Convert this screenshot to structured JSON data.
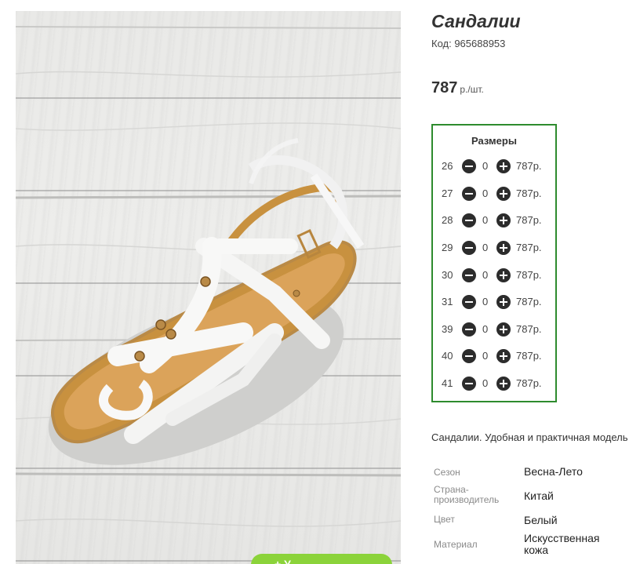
{
  "product": {
    "title": "Сандалии",
    "code_label": "Код: 965688953",
    "price": "787",
    "price_unit": "р./шт."
  },
  "sizes_box": {
    "title": "Размеры",
    "rows": [
      {
        "size": "26",
        "qty": "0",
        "price": "787р."
      },
      {
        "size": "27",
        "qty": "0",
        "price": "787р."
      },
      {
        "size": "28",
        "qty": "0",
        "price": "787р."
      },
      {
        "size": "29",
        "qty": "0",
        "price": "787р."
      },
      {
        "size": "30",
        "qty": "0",
        "price": "787р."
      },
      {
        "size": "31",
        "qty": "0",
        "price": "787р."
      },
      {
        "size": "39",
        "qty": "0",
        "price": "787р."
      },
      {
        "size": "40",
        "qty": "0",
        "price": "787р."
      },
      {
        "size": "41",
        "qty": "0",
        "price": "787р."
      }
    ]
  },
  "description": "Сандалии. Удобная и практичная модель",
  "properties": [
    {
      "key": "Сезон",
      "value": "Весна-Лето"
    },
    {
      "key": "Страна-производитель",
      "value": "Китай"
    },
    {
      "key": "Цвет",
      "value": "Белый"
    },
    {
      "key": "Материал",
      "value": "Искусственная кожа"
    }
  ],
  "cart_button": {
    "label": "+ У"
  },
  "colors": {
    "accent_border": "#2e8b2e",
    "cart_button": "#8bd33a"
  }
}
